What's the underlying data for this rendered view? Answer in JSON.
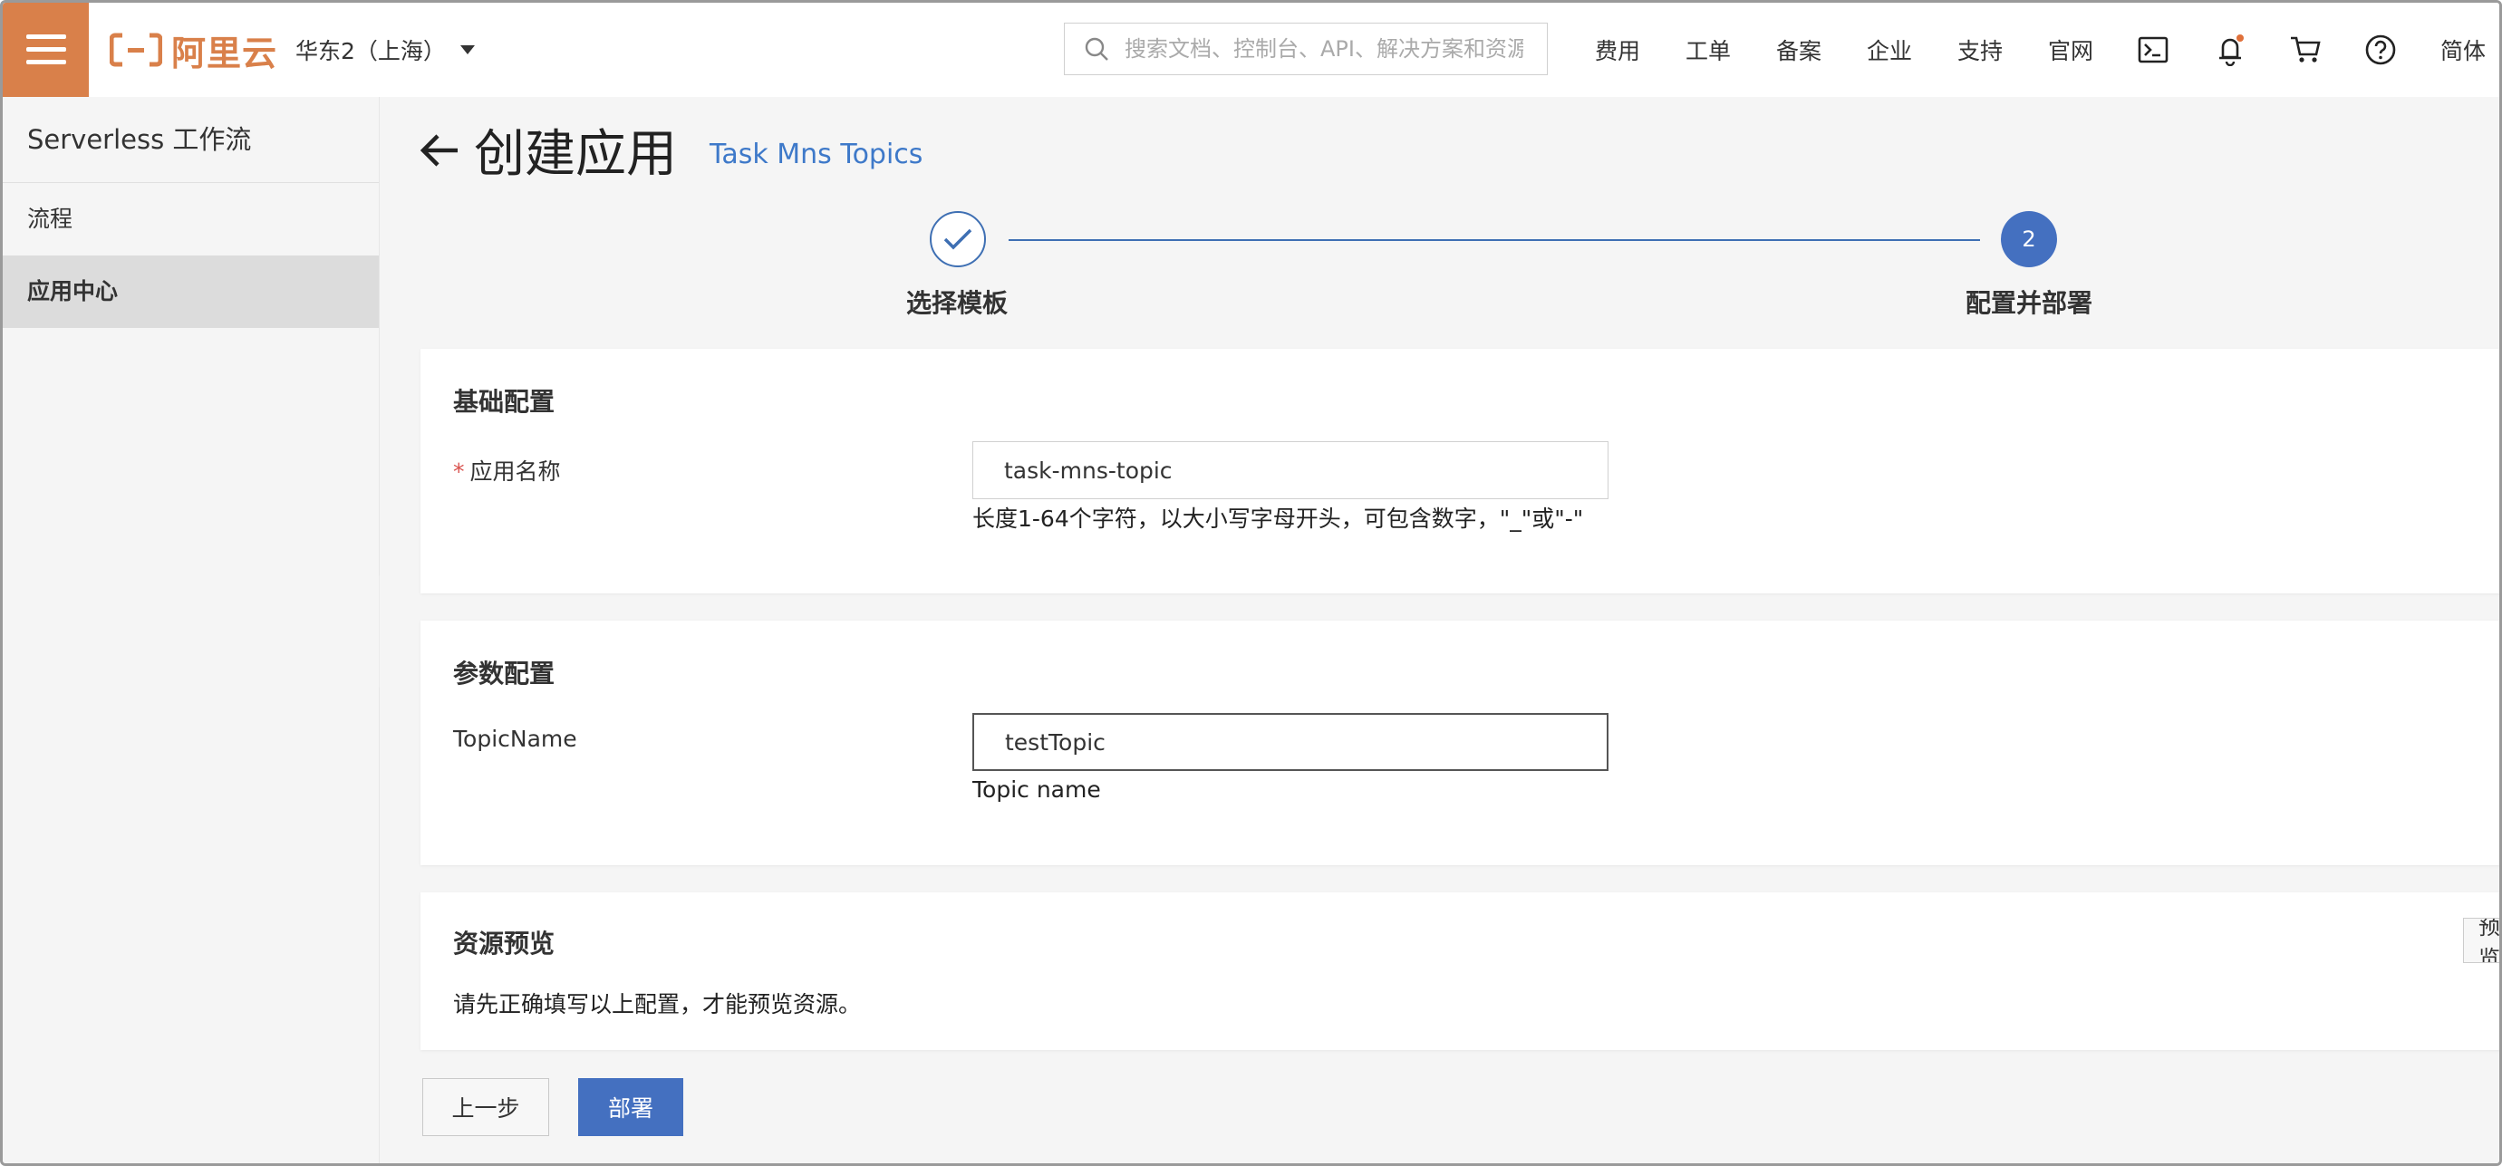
{
  "topbar": {
    "brand": "阿里云",
    "region": "华东2（上海）",
    "search_placeholder": "搜索文档、控制台、API、解决方案和资源",
    "nav": [
      "费用",
      "工单",
      "备案",
      "企业",
      "支持",
      "官网"
    ],
    "language": "简体",
    "accent_color": "#d9804a"
  },
  "sidebar": {
    "title": "Serverless 工作流",
    "items": [
      {
        "label": "流程",
        "active": false
      },
      {
        "label": "应用中心",
        "active": true
      }
    ]
  },
  "page": {
    "title": "创建应用",
    "template_name": "Task Mns Topics"
  },
  "steps": [
    {
      "label": "选择模板",
      "status": "done"
    },
    {
      "label": "配置并部署",
      "number": "2",
      "status": "active"
    }
  ],
  "basic_config": {
    "title": "基础配置",
    "app_name_label": "应用名称",
    "app_name_value": "task-mns-topic",
    "app_name_help": "长度1-64个字符，以大小写字母开头，可包含数字，\"_\"或\"-\""
  },
  "param_config": {
    "title": "参数配置",
    "topic_label": "TopicName",
    "topic_value": "testTopic",
    "topic_help": "Topic name"
  },
  "resource_preview": {
    "title": "资源预览",
    "button_label": "预览",
    "message": "请先正确填写以上配置，才能预览资源。"
  },
  "actions": {
    "prev_label": "上一步",
    "deploy_label": "部署"
  }
}
